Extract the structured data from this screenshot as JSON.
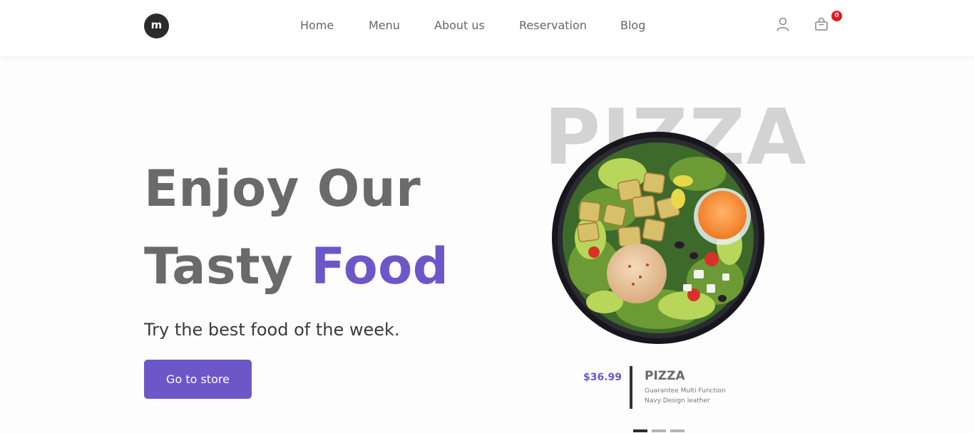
{
  "header": {
    "logo_letter": "m",
    "nav": [
      "Home",
      "Menu",
      "About us",
      "Reservation",
      "Blog"
    ],
    "cart_count": "0"
  },
  "hero": {
    "line1": "Enjoy Our",
    "line2_plain": "Tasty ",
    "line2_accent": "Food",
    "subtitle": "Try the best food of the week.",
    "cta_label": "Go to store"
  },
  "product": {
    "background_word": "PIZZA",
    "price": "$36.99",
    "name": "PIZZA",
    "desc_line1": "Guarantee Multi Function",
    "desc_line2": "Navy Design leather"
  },
  "slider": {
    "count": 3,
    "active_index": 0
  },
  "colors": {
    "accent": "#6c57c9",
    "badge": "#e8161e",
    "dot_active": "#2b2b2b",
    "dot_inactive": "#b5b5b5"
  }
}
